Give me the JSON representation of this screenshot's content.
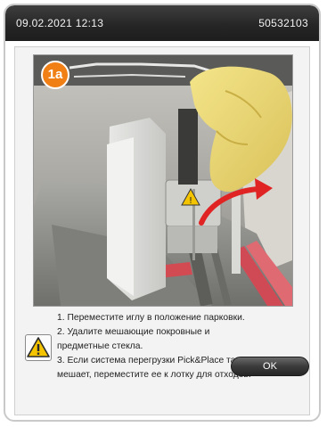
{
  "header": {
    "datetime": "09.02.2021 12:13",
    "serial_number": "50532103"
  },
  "dialog": {
    "step_badge": "1a",
    "instructions": [
      "1. Переместите иглу в положение парковки.",
      "2. Удалите мешающие покровные и",
      "предметные стекла.",
      "3. Если система перегрузки Pick&Place также",
      "мешает, переместите ее к лотку для отходов."
    ],
    "ok_label": "OK"
  },
  "icons": {
    "warning": "warning-triangle-icon",
    "arrow": "curved-arrow-icon"
  },
  "colors": {
    "badge": "#f07f16",
    "arrow": "#e02424",
    "warning_fill": "#f5c400",
    "header_bg": "#262626"
  }
}
